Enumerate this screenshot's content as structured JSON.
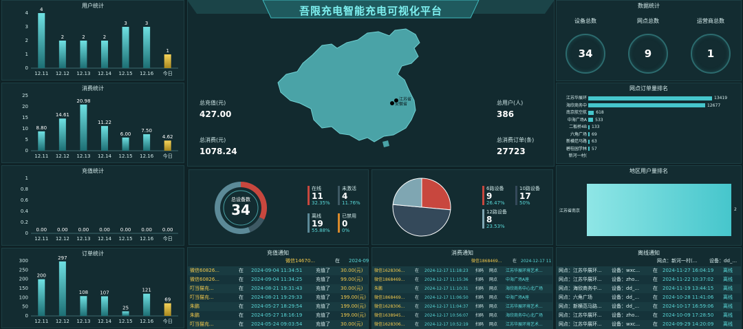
{
  "header": {
    "title": "吾限充电智能充电可视化平台"
  },
  "user_stats": {
    "title": "用户统计",
    "chart_data": {
      "type": "bar",
      "categories": [
        "12.11",
        "12.12",
        "12.13",
        "12.14",
        "12.15",
        "12.16",
        "今日"
      ],
      "values": [
        4,
        2,
        2,
        2,
        3,
        3,
        1
      ],
      "ylim": [
        0,
        4
      ],
      "yticks": [
        "0",
        "1",
        "2",
        "3",
        "4"
      ]
    }
  },
  "consume_stats": {
    "title": "消费统计",
    "chart_data": {
      "type": "bar",
      "categories": [
        "12.11",
        "12.12",
        "12.13",
        "12.14",
        "12.15",
        "12.16",
        "今日"
      ],
      "values": [
        8.8,
        14.61,
        20.98,
        11.22,
        6.0,
        7.5,
        4.62
      ],
      "labels": [
        "8.80",
        "14.61",
        "20.98",
        "11.22",
        "6.00",
        "7.50",
        "4.62"
      ],
      "ylim": [
        0,
        25
      ],
      "yticks": [
        "0",
        "5",
        "10",
        "15",
        "20",
        "25"
      ]
    }
  },
  "recharge_stats": {
    "title": "充值统计",
    "chart_data": {
      "type": "bar",
      "categories": [
        "12.11",
        "12.12",
        "12.13",
        "12.14",
        "12.15",
        "12.16",
        "今日"
      ],
      "values": [
        0,
        0,
        0,
        0,
        0,
        0,
        0
      ],
      "labels": [
        "0.00",
        "0.00",
        "0.00",
        "0.00",
        "0.00",
        "0.00",
        "0.00"
      ],
      "ylim": [
        0,
        1
      ],
      "yticks": [
        "0",
        "0.2",
        "0.4",
        "0.6",
        "0.8",
        "1"
      ]
    }
  },
  "order_stats": {
    "title": "订单统计",
    "chart_data": {
      "type": "bar",
      "categories": [
        "12.11",
        "12.12",
        "12.13",
        "12.14",
        "12.15",
        "12.16",
        "今日"
      ],
      "values": [
        200,
        297,
        108,
        107,
        25,
        121,
        69
      ],
      "ylim": [
        0,
        300
      ],
      "yticks": [
        "0",
        "50",
        "100",
        "150",
        "200",
        "250",
        "300"
      ]
    }
  },
  "summary": {
    "recharge_label": "总充值(元)",
    "recharge_value": "427.00",
    "consume_label": "总消费(元)",
    "consume_value": "1078.24",
    "users_label": "总用户(人)",
    "users_value": "386",
    "orders_label": "总消费订单(条)",
    "orders_value": "27723"
  },
  "map": {
    "city1": "江苏省",
    "city2": "安徽省"
  },
  "data_stats": {
    "title": "数据统计",
    "items": [
      {
        "label": "设备总数",
        "value": "34"
      },
      {
        "label": "网点总数",
        "value": "9"
      },
      {
        "label": "运营商总数",
        "value": "1"
      }
    ]
  },
  "rank": {
    "title": "网点订单量排名",
    "chart_data": {
      "type": "bar",
      "categories": [
        "江苏华展环",
        "海欣商务中",
        "南京航空航",
        "中海广场A",
        "二板桥4B",
        "六角广场",
        "新横范马路",
        "碧桂园学林",
        "新河一村("
      ],
      "values": [
        13419,
        12677,
        618,
        533,
        133,
        69,
        63,
        57,
        0
      ],
      "labels": [
        "13419",
        "12677",
        "618",
        "533",
        "133",
        "69",
        "63",
        "57",
        ""
      ]
    }
  },
  "region": {
    "title": "地区用户量排名",
    "chart_data": {
      "type": "bar",
      "categories": [
        "江苏省南京"
      ],
      "values": [
        2
      ],
      "labels": [
        "2"
      ]
    }
  },
  "device": {
    "center_label": "总设备数",
    "center_value": "34",
    "chart_data": {
      "type": "pie",
      "categories": [
        "在线",
        "未激活",
        "离线",
        "已禁用"
      ],
      "values": [
        11,
        4,
        19,
        0
      ],
      "pcts": [
        "32.35%",
        "11.76%",
        "55.88%",
        "0%"
      ]
    }
  },
  "ports": {
    "chart_data": {
      "type": "pie",
      "categories": [
        "6路设备",
        "10路设备",
        "12路设备"
      ],
      "values": [
        9,
        17,
        8
      ],
      "pcts": [
        "26.47%",
        "50%",
        "23.53%"
      ]
    }
  },
  "recharge_notice": {
    "title": "充值通知",
    "top": {
      "name": "微信14670...",
      "at": "在",
      "time": "2024-09"
    },
    "rows": [
      {
        "name": "微信60826...",
        "at": "在",
        "time": "2024-09-04 11:34:51",
        "act": "充值了",
        "amt": "30.00(元)"
      },
      {
        "name": "微信60826...",
        "at": "在",
        "time": "2024-09-04 11:34:25",
        "act": "充值了",
        "amt": "99.00(元)"
      },
      {
        "name": "叮当猫充...",
        "at": "在",
        "time": "2024-08-21 19:31:43",
        "act": "充值了",
        "amt": "30.00(元)"
      },
      {
        "name": "叮当猫充...",
        "at": "在",
        "time": "2024-08-21 19:29:33",
        "act": "充值了",
        "amt": "199.00(元)"
      },
      {
        "name": "朱鹏",
        "at": "在",
        "time": "2024-05-27 18:29:54",
        "act": "充值了",
        "amt": "199.00(元)"
      },
      {
        "name": "朱鹏",
        "at": "在",
        "time": "2024-05-27 18:16:19",
        "act": "充值了",
        "amt": "199.00(元)"
      },
      {
        "name": "叮当猫充...",
        "at": "在",
        "time": "2024-05-24 09:03:54",
        "act": "充值了",
        "amt": "30.00(元)"
      }
    ]
  },
  "consume_notice": {
    "title": "消费通知",
    "top": {
      "name": "微信1868469...",
      "at": "在",
      "time": "2024-12-17 11"
    },
    "rows": [
      {
        "name": "微信1628306...",
        "at": "在",
        "time": "2024-12-17 11:18:23",
        "act": "扫码",
        "loc": "网点",
        "place": "江苏华展环境艺术..."
      },
      {
        "name": "微信1868469...",
        "at": "在",
        "time": "2024-12-17 11:15:36",
        "act": "扫码",
        "loc": "网点",
        "place": "中海广场A座"
      },
      {
        "name": "朱鹏",
        "at": "在",
        "time": "2024-12-17 11:10:31",
        "act": "扫码",
        "loc": "网点",
        "place": "海欣商务中心北广场"
      },
      {
        "name": "微信1868469...",
        "at": "在",
        "time": "2024-12-17 11:06:50",
        "act": "扫码",
        "loc": "网点",
        "place": "中海广场A座"
      },
      {
        "name": "微信1628306...",
        "at": "在",
        "time": "2024-12-17 11:04:37",
        "act": "扫码",
        "loc": "网点",
        "place": "江苏华展环境艺术..."
      },
      {
        "name": "微信1638945...",
        "at": "在",
        "time": "2024-12-17 10:56:07",
        "act": "扫码",
        "loc": "网点",
        "place": "海欣商务中心北广场"
      },
      {
        "name": "微信1628306...",
        "at": "在",
        "time": "2024-12-17 10:52:19",
        "act": "扫码",
        "loc": "网点",
        "place": "江苏华展环境艺术..."
      }
    ]
  },
  "offline_notice": {
    "title": "离线通知",
    "top": {
      "site": "网点：新河一村(...",
      "dev": "设备：dd_..."
    },
    "rows": [
      {
        "site": "网点：江苏华展环...",
        "dev": "设备：wxc...",
        "at": "在",
        "time": "2024-11-27 16:04:19",
        "st": "离线"
      },
      {
        "site": "网点：江苏华展环...",
        "dev": "设备：zho...",
        "at": "在",
        "time": "2024-11-22 10:37:02",
        "st": "离线"
      },
      {
        "site": "网点：海欣商务中...",
        "dev": "设备：dd_...",
        "at": "在",
        "time": "2024-11-19 13:44:15",
        "st": "离线"
      },
      {
        "site": "网点：六角广场",
        "dev": "设备：dd_...",
        "at": "在",
        "time": "2024-10-28 11:41:06",
        "st": "离线"
      },
      {
        "site": "网点：新横范马路...",
        "dev": "设备：dd_...",
        "at": "在",
        "time": "2024-10-17 16:59:06",
        "st": "离线"
      },
      {
        "site": "网点：江苏华展环...",
        "dev": "设备：zho...",
        "at": "在",
        "time": "2024-10-09 17:28:50",
        "st": "离线"
      },
      {
        "site": "网点：江苏华展环...",
        "dev": "设备：wxc...",
        "at": "在",
        "time": "2024-09-29 14:20:09",
        "st": "离线"
      }
    ]
  }
}
